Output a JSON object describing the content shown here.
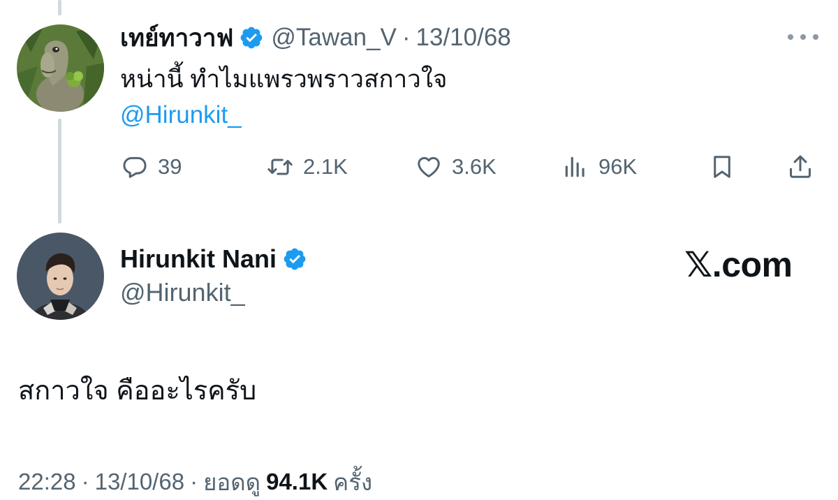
{
  "reply_tweet": {
    "display_name": "เทย์ทาวาฟ",
    "handle": "@Tawan_V",
    "separator": "·",
    "date": "13/10/68",
    "text": "หน่านี้ ทำไมแพรวพราวสกาวใจ",
    "mention": "@Hirunkit_",
    "actions": {
      "replies": "39",
      "reposts": "2.1K",
      "likes": "3.6K",
      "views": "96K"
    }
  },
  "main_tweet": {
    "display_name": "Hirunkit Nani",
    "handle": "@Hirunkit_",
    "text": "สกาวใจ คืออะไรครับ",
    "time": "22:28",
    "separator": "·",
    "date": "13/10/68",
    "views_label": "ยอดดู",
    "views_count": "94.1K",
    "views_suffix": "ครั้ง"
  },
  "brand": {
    "x_mark": "𝕏",
    "domain_suffix": ".com"
  },
  "icons": {
    "verified": "verified-badge-icon",
    "more": "more-icon",
    "reply": "reply-icon",
    "repost": "repost-icon",
    "like": "heart-icon",
    "views": "views-chart-icon",
    "bookmark": "bookmark-icon",
    "share": "share-icon"
  },
  "colors": {
    "verified": "#1d9bf0",
    "link": "#1d9bf0",
    "muted": "#536471",
    "text": "#0f1419",
    "thread_line": "#cfd9de"
  }
}
